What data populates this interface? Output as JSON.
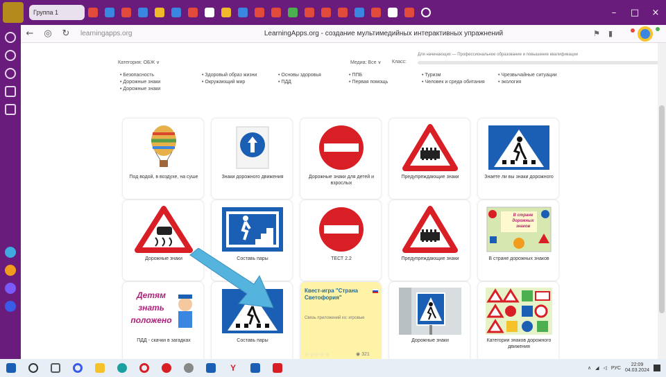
{
  "browser": {
    "tab_label": "Группа 1",
    "url": "learningapps.org",
    "page_title": "LearningApps.org - создание мультимедийных интерактивных упражнений",
    "window_controls": [
      "–",
      "□",
      "×"
    ]
  },
  "filters": {
    "category": "Категория: ОБЖ ∨",
    "mode": "Медиа: Все ∨",
    "sort": "Класс:",
    "range_label": "Для начинающих — Профессиональное образование и повышение квалификации"
  },
  "topics": [
    [
      "Безопасность",
      "Дорожные знаки",
      "Дорожные знаки"
    ],
    [
      "Здоровый образ жизни",
      "Окружающий мир"
    ],
    [
      "Основы здоровья",
      "ПДД"
    ],
    [
      "ППБ",
      "Первая помощь"
    ],
    [
      "Туризм",
      "Человек и среда обитания"
    ],
    [
      "Чрезвычайные ситуации",
      "экология"
    ]
  ],
  "tiles": [
    {
      "caption": "Под водой, в воздухе, на суше",
      "art": "balloon"
    },
    {
      "caption": "Знаки дорожного движения",
      "art": "arrow-up-sign"
    },
    {
      "caption": "Дорожные знаки для детей и взрослых",
      "art": "no-entry"
    },
    {
      "caption": "Предупреждающие знаки",
      "art": "rail-crossing"
    },
    {
      "caption": "Знаете ли вы знаки дорожного",
      "art": "crosswalk-blue"
    },
    {
      "caption": "Дорожные знаки",
      "art": "slippery-road"
    },
    {
      "caption": "Составь пары",
      "art": "underpass-sign"
    },
    {
      "caption": "ТЕСТ 2.2",
      "art": "no-entry"
    },
    {
      "caption": "Предупреждающие знаки",
      "art": "rail-crossing"
    },
    {
      "caption": "В стране дорожных знаков",
      "art": "signs-poster",
      "poster_text": "В стране дорожных знаков"
    },
    {
      "caption": "ПДД - скачки в загадках",
      "art": "policeman",
      "poster_text": "Детям знать положено"
    },
    {
      "caption": "Составь пары",
      "art": "crosswalk-blue"
    },
    {
      "caption": "",
      "art": "yellow-card",
      "title": "Квест-игра \"Страна Светофория\"",
      "subtitle": "Связь приложений ко: игровые",
      "count": "321"
    },
    {
      "caption": "Дорожные знаки",
      "art": "crosswalk-photo"
    },
    {
      "caption": "Категории знаков дорожного движения",
      "art": "categories"
    }
  ],
  "taskbar": {
    "lang": "РУС",
    "time": "22:09",
    "date": "04.03.2024"
  },
  "colors": {
    "browser_chrome": "#6a1c7c",
    "sign_red": "#d91f26",
    "sign_blue": "#1b5fb4",
    "arrow_blue": "#55b4dd"
  }
}
